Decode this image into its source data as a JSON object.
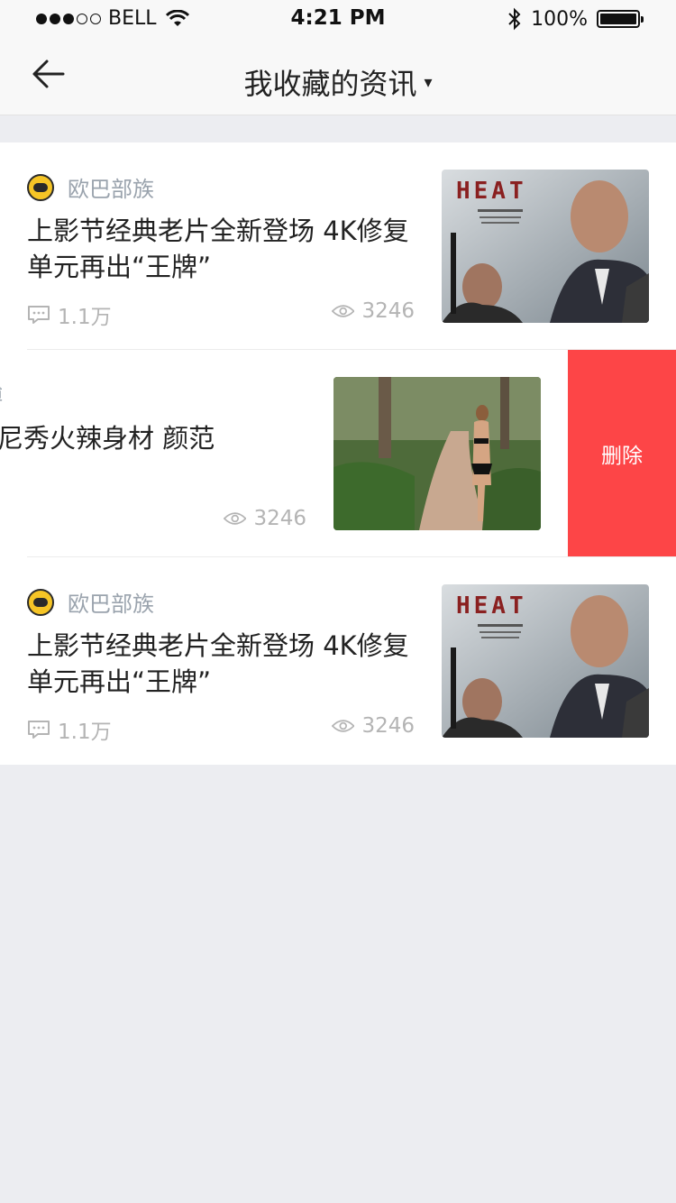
{
  "status_bar": {
    "carrier": "BELL",
    "time": "4:21 PM",
    "battery": "100%",
    "battery_level": 1.0
  },
  "nav": {
    "title": "我收藏的资讯",
    "caret": "▾"
  },
  "items": [
    {
      "source": "欧巴部族",
      "headline": "上影节经典老片全新登场 4K修复单元再出“王牌”",
      "comments": "1.1万",
      "views": "3246",
      "thumb": "heat-poster"
    },
    {
      "source": "微博",
      "headline": "穿比基尼秀火辣身材 颜范",
      "views": "3246",
      "thumb": "forest-path-photo",
      "delete_label": "删除"
    },
    {
      "source": "欧巴部族",
      "headline": "上影节经典老片全新登场 4K修复单元再出“王牌”",
      "comments": "1.1万",
      "views": "3246",
      "thumb": "heat-poster"
    }
  ],
  "icons": {
    "back": "arrow-left-icon",
    "comment": "comment-icon",
    "views": "eye-icon",
    "bluetooth": "bluetooth-icon",
    "wifi": "wifi-icon"
  },
  "colors": {
    "delete": "#fd4547",
    "background": "#ecedf1",
    "meta": "#b4b4b4",
    "source": "#9aa3ad"
  }
}
